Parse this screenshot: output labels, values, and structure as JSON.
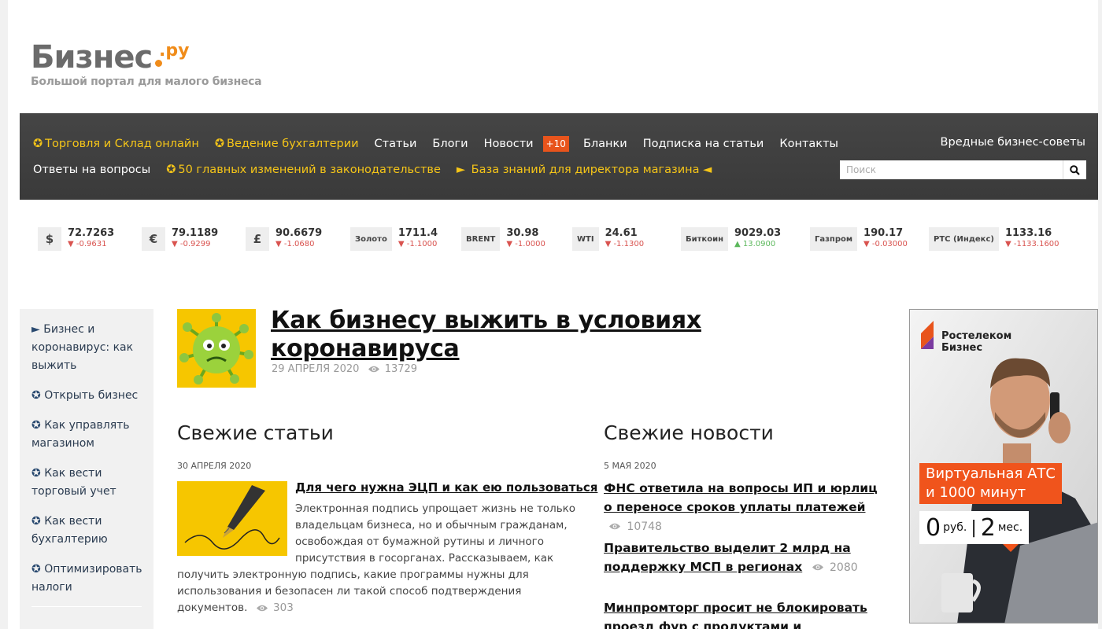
{
  "logo": {
    "name": "Бизнес",
    "domain": ".ру",
    "tagline": "Большой портал для малого бизнеса"
  },
  "nav": {
    "row1": [
      {
        "label": "Торговля и Склад онлайн",
        "highlight": true
      },
      {
        "label": "Ведение бухгалтерии",
        "highlight": true
      },
      {
        "label": "Статьи",
        "highlight": false
      },
      {
        "label": "Блоги",
        "highlight": false
      },
      {
        "label": "Новости",
        "highlight": false
      }
    ],
    "news_badge": "+10",
    "row1_after": [
      {
        "label": "Бланки"
      },
      {
        "label": "Подписка на статьи"
      },
      {
        "label": "Контакты"
      }
    ],
    "row2": [
      {
        "label": "Ответы на вопросы",
        "prefix": ""
      },
      {
        "label": "50 главных изменений в законодательстве",
        "prefix": "✪"
      },
      {
        "label": "База знаний для директора магазина",
        "prefix": "►",
        "suffix": "◄"
      }
    ],
    "right_link": "Вредные бизнес-советы",
    "search_placeholder": "Поиск"
  },
  "ticker": [
    {
      "symbol": "$",
      "value": "72.7263",
      "change": "-0.9631",
      "up": false
    },
    {
      "symbol": "€",
      "value": "79.1189",
      "change": "-0.9299",
      "up": false
    },
    {
      "symbol": "£",
      "value": "90.6679",
      "change": "-1.0680",
      "up": false
    },
    {
      "symbol": "Золото",
      "value": "1711.4",
      "change": "-1.1000",
      "up": false
    },
    {
      "symbol": "BRENT",
      "value": "30.98",
      "change": "-1.0000",
      "up": false
    },
    {
      "symbol": "WTI",
      "value": "24.61",
      "change": "-1.1300",
      "up": false
    },
    {
      "symbol": "Биткоин",
      "value": "9029.03",
      "change": "13.0900",
      "up": true
    },
    {
      "symbol": "Газпром",
      "value": "190.17",
      "change": "-0.03000",
      "up": false
    },
    {
      "symbol": "РТС (Индекс)",
      "value": "1133.16",
      "change": "-1133.1600",
      "up": false
    }
  ],
  "sidebar": [
    {
      "marker": "►",
      "label": "Бизнес и коронавирус: как выжить"
    },
    {
      "marker": "✪",
      "label": "Открыть бизнес"
    },
    {
      "marker": "✪",
      "label": "Как управлять магазином"
    },
    {
      "marker": "✪",
      "label": "Как вести торговый учет"
    },
    {
      "marker": "✪",
      "label": "Как вести бухгалтерию"
    },
    {
      "marker": "✪",
      "label": "Оптимизировать налоги"
    }
  ],
  "featured": {
    "title": "Как бизнесу выжить в условиях коронавируса",
    "date": "29 АПРЕЛЯ 2020",
    "views": "13729"
  },
  "articles": {
    "heading": "Свежие статьи",
    "date": "30 АПРЕЛЯ 2020",
    "item": {
      "title": "Для чего нужна ЭЦП и как ею пользоваться",
      "body": "Электронная подпись упрощает жизнь не только владельцам бизнеса, но и обычным гражданам, освобождая от бумажной рутины и личного присутствия в госорганах. Рассказываем, как получить электронную подпись, какие программы нужны для использования и безопасен ли такой способ подтверждения документов.",
      "views": "303"
    }
  },
  "news": {
    "heading": "Свежие новости",
    "date": "5 МАЯ 2020",
    "items": [
      {
        "title": "ФНС ответила на вопросы ИП и юрлиц о переносе сроков уплаты платежей",
        "views": "10748"
      },
      {
        "title": "Правительство выделит 2 млрд на поддержку МСП в регионах",
        "views": "2080"
      },
      {
        "title": "Минпромторг просит не блокировать проезд фур с продуктами и",
        "views": ""
      }
    ]
  },
  "ad": {
    "brand_line1": "Ростелеком",
    "brand_line2": "Бизнес",
    "headline_line1": "Виртуальная АТС",
    "headline_line2": "и 1000 минут",
    "price_big": "0",
    "price_unit": "руб.",
    "period_big": "2",
    "period_unit": "мес."
  }
}
